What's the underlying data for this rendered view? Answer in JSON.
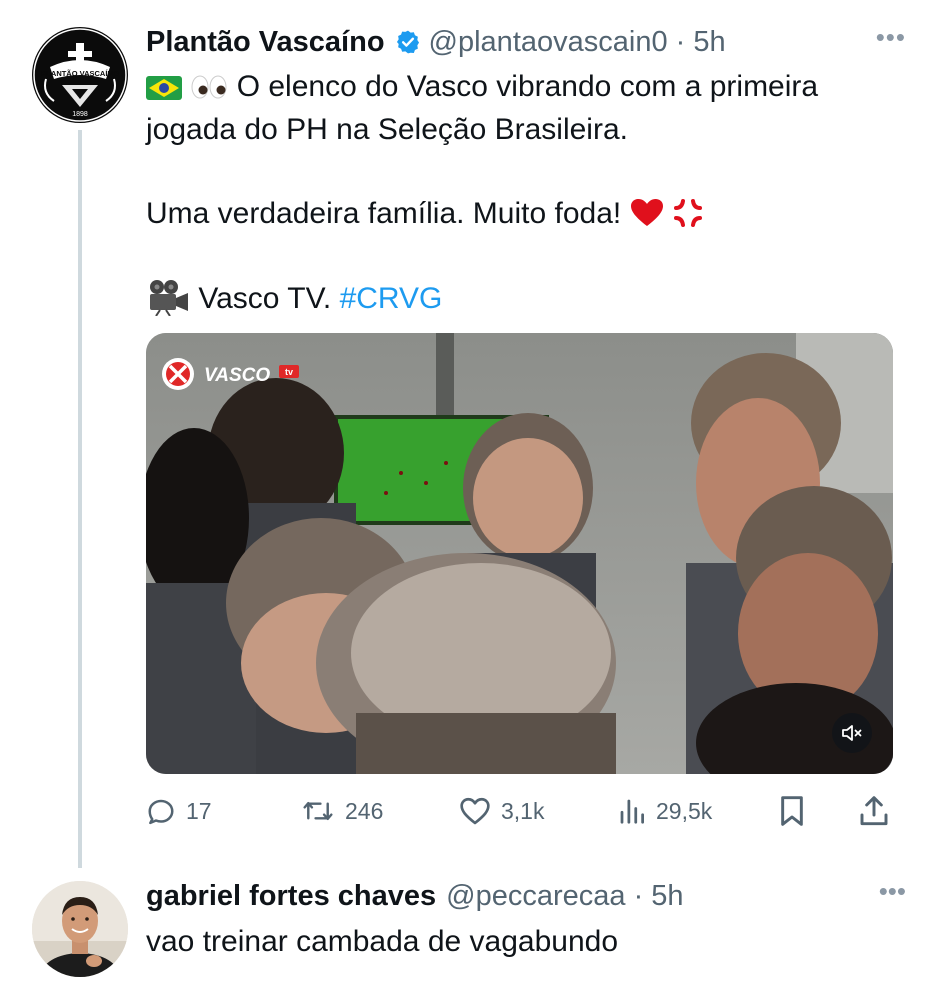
{
  "tweet": {
    "author_name": "Plantão Vascaíno",
    "author_handle": "@plantaovascain0",
    "time": "5h",
    "more": "•••",
    "avatar_text": "PLANTÃO VASCAÍNO",
    "avatar_year": "1898",
    "line1": "O elenco do Vasco vibrando com a primeira",
    "line2": "jogada do PH na Seleção Brasileira.",
    "line3": "Uma verdadeira família. Muito foda!",
    "line4_text": "Vasco TV.",
    "hashtag": "#CRVG",
    "media_logo": "VASCO",
    "media_logo_badge": "tv",
    "actions": {
      "replies": "17",
      "retweets": "246",
      "likes": "3,1k",
      "views": "29,5k"
    }
  },
  "reply": {
    "author_name": "gabriel fortes chaves",
    "author_handle": "@peccarecaa",
    "time": "5h",
    "more": "•••",
    "text": "vao treinar cambada de vagabundo"
  },
  "colors": {
    "accent": "#1d9bf0",
    "muted": "#536471",
    "text": "#0f1419",
    "thread_line": "#cfd9de"
  }
}
